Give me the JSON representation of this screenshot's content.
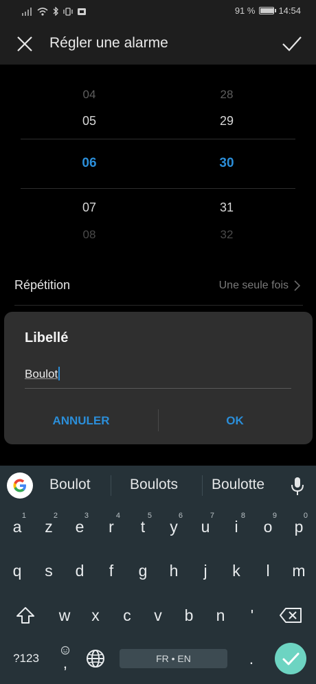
{
  "status_bar": {
    "battery_text": "91 %",
    "battery_level": 0.91,
    "time": "14:54",
    "icons": [
      "signal-icon",
      "wifi-icon",
      "bluetooth-icon",
      "vibrate-icon",
      "nfc-icon"
    ]
  },
  "app_bar": {
    "title": "Régler une alarme",
    "close_icon": "close-icon",
    "confirm_icon": "check-icon"
  },
  "time_picker": {
    "hours": [
      "04",
      "05",
      "06",
      "07",
      "08"
    ],
    "minutes": [
      "28",
      "29",
      "30",
      "31",
      "32"
    ],
    "selected_hour": "06",
    "selected_minute": "30"
  },
  "repeat": {
    "label": "Répétition",
    "value": "Une seule fois"
  },
  "dialog": {
    "title": "Libellé",
    "input_value": "Boulot",
    "cancel_label": "ANNULER",
    "ok_label": "OK"
  },
  "suggestions": [
    "Boulot",
    "Boulots",
    "Boulotte"
  ],
  "keyboard": {
    "row1": [
      {
        "key": "a",
        "num": "1"
      },
      {
        "key": "z",
        "num": "2"
      },
      {
        "key": "e",
        "num": "3"
      },
      {
        "key": "r",
        "num": "4"
      },
      {
        "key": "t",
        "num": "5"
      },
      {
        "key": "y",
        "num": "6"
      },
      {
        "key": "u",
        "num": "7"
      },
      {
        "key": "i",
        "num": "8"
      },
      {
        "key": "o",
        "num": "9"
      },
      {
        "key": "p",
        "num": "0"
      }
    ],
    "row2": [
      "q",
      "s",
      "d",
      "f",
      "g",
      "h",
      "j",
      "k",
      "l",
      "m"
    ],
    "row3": [
      "w",
      "x",
      "c",
      "v",
      "b",
      "n",
      "'"
    ],
    "symbols_label": "?123",
    "emoji_key": ",",
    "period_key": ".",
    "space_label": "FR • EN"
  },
  "colors": {
    "accent": "#2b8ed9",
    "keyboard_bg": "#263238",
    "fab": "#6dd4c2"
  }
}
